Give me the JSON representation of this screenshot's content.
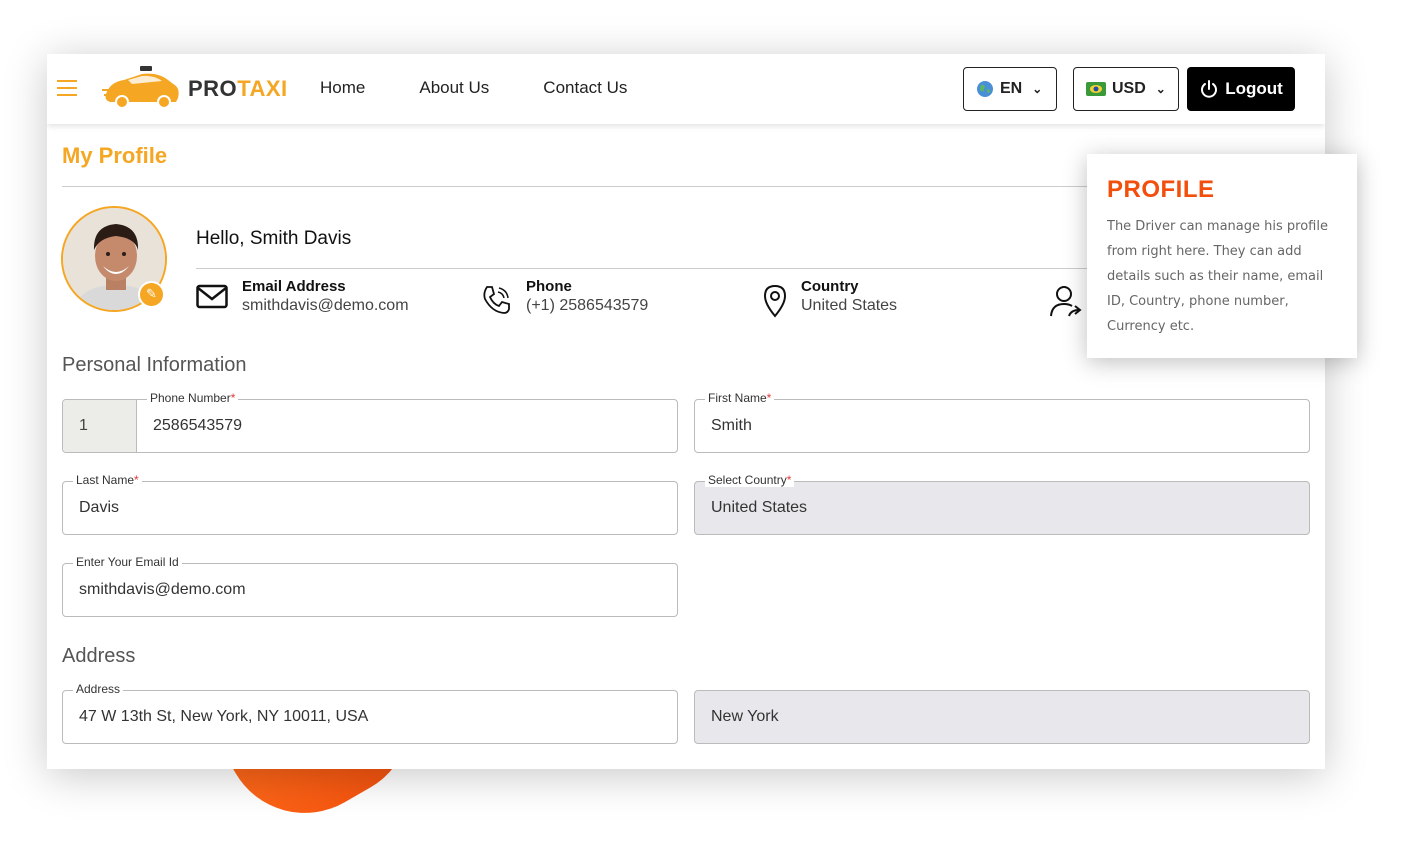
{
  "brand": {
    "part1": "PRO",
    "part2": "TAXI"
  },
  "nav": {
    "home": "Home",
    "about": "About Us",
    "contact": "Contact Us"
  },
  "header": {
    "language": "EN",
    "currency": "USD",
    "logout": "Logout"
  },
  "colors": {
    "accent": "#f5a623",
    "highlight": "#f24e0c",
    "logout_bg": "#000000"
  },
  "profile": {
    "page_title": "My Profile",
    "greeting": "Hello, Smith Davis",
    "email_label": "Email Address",
    "email_value": "smithdavis@demo.com",
    "phone_label": "Phone",
    "phone_value": "(+1) 2586543579",
    "country_label": "Country",
    "country_value": "United States"
  },
  "personal_info": {
    "title": "Personal Information",
    "phone_code": "1",
    "phone_label": "Phone Number",
    "phone_value": "2586543579",
    "first_name_label": "First Name",
    "first_name_value": "Smith",
    "last_name_label": "Last Name",
    "last_name_value": "Davis",
    "country_label": "Select Country",
    "country_value": "United States",
    "email_label": "Enter Your Email Id",
    "email_value": "smithdavis@demo.com"
  },
  "address": {
    "title": "Address",
    "address_label": "Address",
    "address_value": "47 W 13th St, New York, NY 10011, USA",
    "city_value": "New York"
  },
  "tooltip": {
    "title": "PROFILE",
    "body": "The Driver can manage his profile from right here. They can add details such as their name, email ID, Country, phone number, Currency etc."
  },
  "icons": [
    "menu-icon",
    "taxi-logo-icon",
    "globe-icon",
    "flag-icon",
    "chevron-down-icon",
    "power-icon",
    "pencil-icon",
    "envelope-icon",
    "phone-icon",
    "location-pin-icon",
    "user-share-icon"
  ]
}
